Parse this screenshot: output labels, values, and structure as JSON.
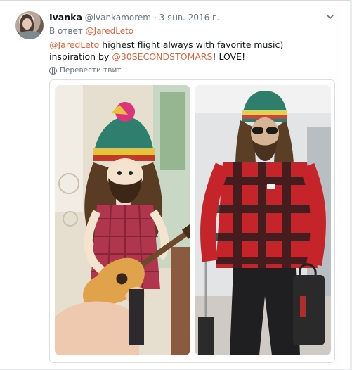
{
  "tweet": {
    "author_name": "Ivanka",
    "author_handle": "@ivankamorem",
    "separator": "·",
    "date": "3 янв. 2016 г.",
    "reply_prefix": "В ответ",
    "reply_to": "@JaredLeto",
    "text_mention": "@JaredLeto",
    "text_body": " highest flight always with favorite music) inspiration by ",
    "text_mention2": "@30SECONDSTOMARS",
    "text_tail": "! LOVE!",
    "translate_label": "Перевести твит"
  },
  "media": {
    "images": [
      {
        "name": "doll-guitar-photo"
      },
      {
        "name": "man-plaid-shirt-photo"
      }
    ]
  },
  "colors": {
    "link": "#e2643b",
    "meta": "#657786",
    "text": "#14171a",
    "border": "#d8e0e6"
  }
}
